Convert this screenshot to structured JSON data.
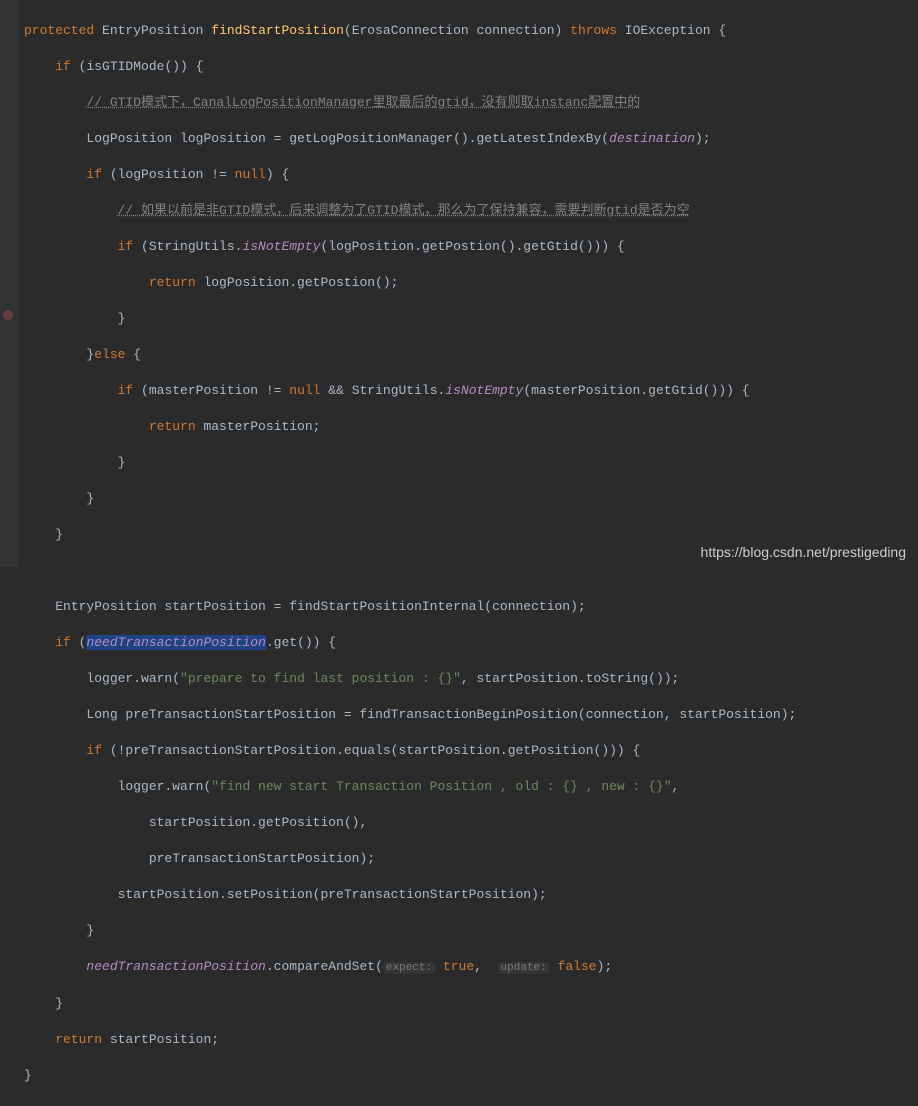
{
  "code": {
    "l1": {
      "kw1": "protected",
      "type1": "EntryPosition",
      "method": "findStartPosition",
      "params": "(ErosaConnection connection)",
      "kw2": "throws",
      "exc": "IOException",
      "brace": " {"
    },
    "l2": {
      "kw": "if",
      "cond": " (isGTIDMode()) {"
    },
    "l3": {
      "comment": "// GTID模式下，CanalLogPositionManager里取最后的gtid，没有则取instanc配置中的"
    },
    "l4": {
      "t1": "LogPosition logPosition = getLogPositionManager().getLatestIndexBy(",
      "p": "destination",
      "t2": ");"
    },
    "l5": {
      "kw": "if",
      "t1": " (logPosition != ",
      "kw2": "null",
      "t2": ") {"
    },
    "l6": {
      "comment": "// 如果以前是非GTID模式，后来调整为了GTID模式，那么为了保持兼容，需要判断gtid是否为空"
    },
    "l7": {
      "kw": "if",
      "t1": " (StringUtils.",
      "sm": "isNotEmpty",
      "t2": "(logPosition.getPostion().getGtid())) {"
    },
    "l8": {
      "kw": "return",
      "t": " logPosition.getPostion();"
    },
    "l9": {
      "t": "}"
    },
    "l10": {
      "t1": "}",
      "kw": "else",
      "t2": " {"
    },
    "l11": {
      "kw": "if",
      "t1": " (masterPosition != ",
      "kw2": "null",
      "t2": " && StringUtils.",
      "sm": "isNotEmpty",
      "t3": "(masterPosition.getGtid())) {"
    },
    "l12": {
      "kw": "return",
      "t": " masterPosition;"
    },
    "l13": {
      "t": "}"
    },
    "l14": {
      "t": "}"
    },
    "l15": {
      "t": "}"
    },
    "l16": {
      "t": ""
    },
    "l17": {
      "t": "EntryPosition startPosition = findStartPositionInternal(connection);"
    },
    "l18": {
      "kw": "if",
      "t1": " (",
      "hf": "needTransactionPosition",
      "t2": ".get()) {"
    },
    "l19": {
      "t1": "logger.warn(",
      "s": "\"prepare to find last position : {}\"",
      "t2": ", startPosition.toString());"
    },
    "l20": {
      "t": "Long preTransactionStartPosition = findTransactionBeginPosition(connection, startPosition);"
    },
    "l21": {
      "kw": "if",
      "t": " (!preTransactionStartPosition.equals(startPosition.getPosition())) {"
    },
    "l22": {
      "t1": "logger.warn(",
      "s": "\"find new start Transaction Position , old : {} , new : {}\"",
      "t2": ","
    },
    "l23": {
      "t": "startPosition.getPosition(),"
    },
    "l24": {
      "t": "preTransactionStartPosition);"
    },
    "l25": {
      "t": "startPosition.setPosition(preTransactionStartPosition);"
    },
    "l26": {
      "t": "}"
    },
    "l27": {
      "f": "needTransactionPosition",
      "t1": ".compareAndSet(",
      "h1": "expect:",
      "kw1": " true",
      "t2": ", ",
      "h2": "update:",
      "kw2": " false",
      "t3": ");"
    },
    "l28": {
      "t": "}"
    },
    "l29": {
      "kw": "return",
      "t": " startPosition;"
    },
    "l30": {
      "t": "}"
    }
  },
  "watermark": "https://blog.csdn.net/prestigeding"
}
